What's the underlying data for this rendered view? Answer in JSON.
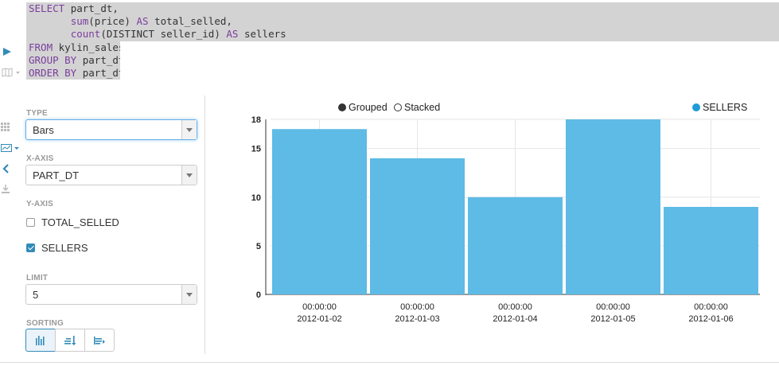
{
  "editor": {
    "lines": [
      [
        {
          "t": "SELECT ",
          "c": "kw"
        },
        {
          "t": "part_dt,",
          "c": ""
        }
      ],
      [
        {
          "t": "       ",
          "c": ""
        },
        {
          "t": "sum",
          "c": "fn"
        },
        {
          "t": "(price) ",
          "c": ""
        },
        {
          "t": "AS",
          "c": "kw"
        },
        {
          "t": " total_selled,",
          "c": ""
        }
      ],
      [
        {
          "t": "       ",
          "c": ""
        },
        {
          "t": "count",
          "c": "fn"
        },
        {
          "t": "(DISTINCT seller_id) ",
          "c": ""
        },
        {
          "t": "AS",
          "c": "kw"
        },
        {
          "t": " sellers",
          "c": ""
        }
      ],
      [
        {
          "t": "FROM",
          "c": "kw"
        },
        {
          "t": " kylin_sales",
          "c": ""
        }
      ],
      [
        {
          "t": "GROUP BY",
          "c": "kw"
        },
        {
          "t": " part_dt",
          "c": ""
        }
      ],
      [
        {
          "t": "ORDER BY",
          "c": "kw"
        },
        {
          "t": " part_dt",
          "c": ""
        }
      ]
    ]
  },
  "settings": {
    "type_label": "TYPE",
    "type_value": "Bars",
    "xaxis_label": "X-AXIS",
    "xaxis_value": "PART_DT",
    "yaxis_label": "Y-AXIS",
    "yaxis_options": [
      {
        "label": "TOTAL_SELLED",
        "checked": false
      },
      {
        "label": "SELLERS",
        "checked": true
      }
    ],
    "limit_label": "LIMIT",
    "limit_value": "5",
    "sorting_label": "SORTING"
  },
  "chart_controls": {
    "grouped_label": "Grouped",
    "stacked_label": "Stacked",
    "series_legend": "SELLERS"
  },
  "colors": {
    "accent": "#338bb8",
    "bar": "#5ebbe5",
    "legend_dot": "#1f9bd7"
  },
  "chart_data": {
    "type": "bar",
    "categories": [
      [
        "00:00:00",
        "2012-01-02"
      ],
      [
        "00:00:00",
        "2012-01-03"
      ],
      [
        "00:00:00",
        "2012-01-04"
      ],
      [
        "00:00:00",
        "2012-01-05"
      ],
      [
        "00:00:00",
        "2012-01-06"
      ]
    ],
    "series": [
      {
        "name": "SELLERS",
        "values": [
          17,
          14,
          10,
          18,
          9
        ]
      }
    ],
    "yticks": [
      "0",
      "5",
      "10",
      "15",
      "18"
    ],
    "ytick_values": [
      0,
      5,
      10,
      15,
      18
    ],
    "ylim": [
      0,
      18
    ],
    "grid": true,
    "legend": "top-right"
  }
}
